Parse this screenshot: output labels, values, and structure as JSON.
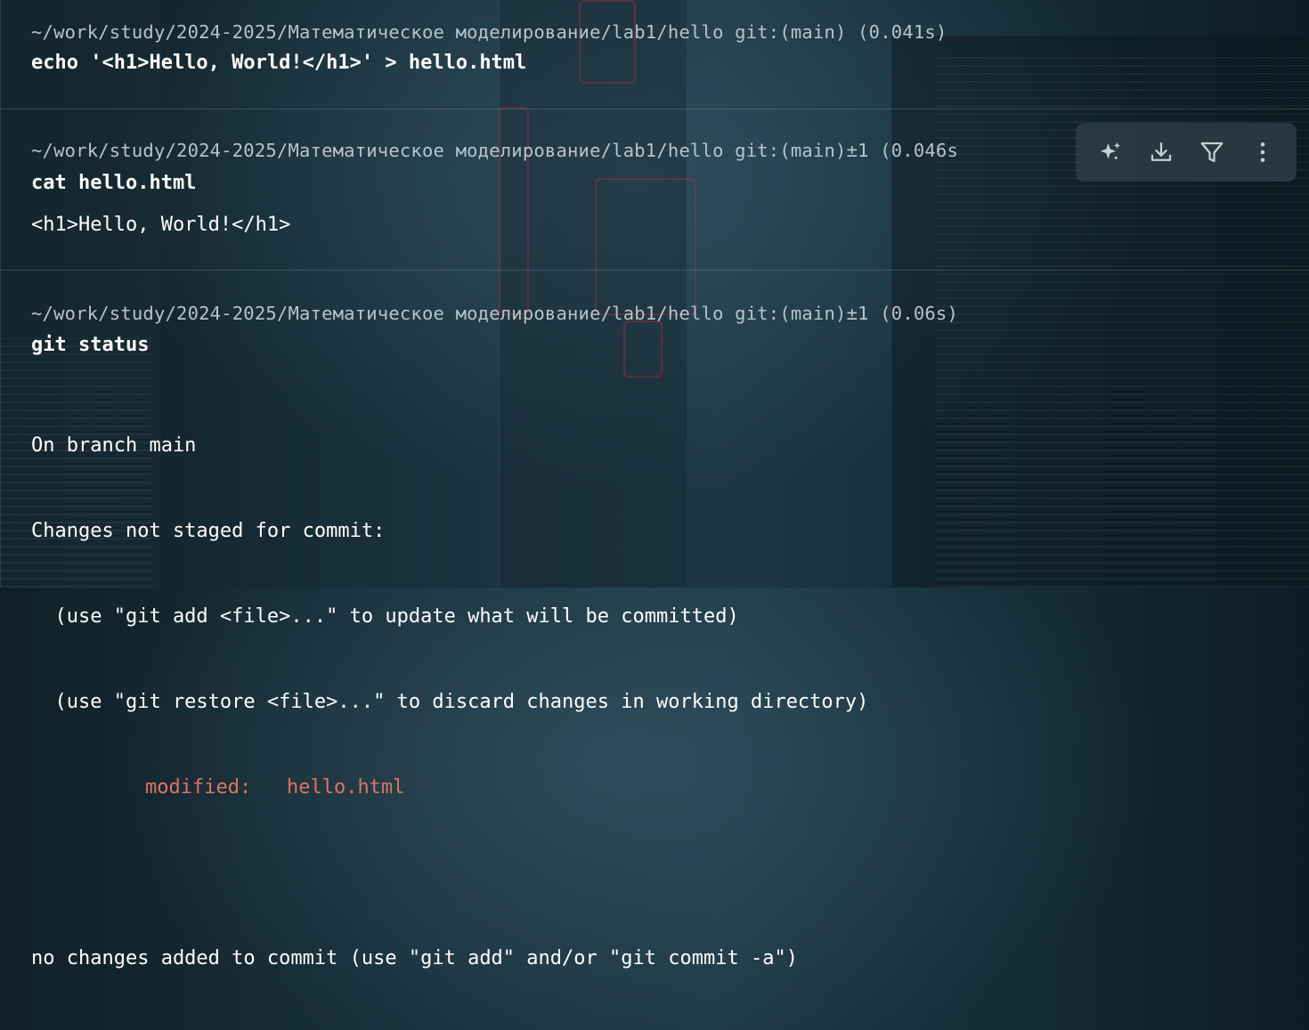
{
  "blocks": [
    {
      "prompt": "~/work/study/2024-2025/Математическое моделирование/lab1/hello git:(main) (0.041s)",
      "command": "echo '<h1>Hello, World!</h1>' > hello.html"
    },
    {
      "prompt": "~/work/study/2024-2025/Математическое моделирование/lab1/hello git:(main)±1 (0.046s",
      "command": "cat hello.html",
      "output": "<h1>Hello, World!</h1>"
    },
    {
      "prompt": "~/work/study/2024-2025/Математическое моделирование/lab1/hello git:(main)±1 (0.06s)",
      "command": "git status",
      "output_lines": [
        "On branch main",
        "Changes not staged for commit:",
        "  (use \"git add <file>...\" to update what will be committed)",
        "  (use \"git restore <file>...\" to discard changes in working directory)"
      ],
      "modified_label": "modified:",
      "modified_file": "hello.html",
      "footer": "no changes added to commit (use \"git add\" and/or \"git commit -a\")"
    }
  ],
  "toolbar": {
    "icons": [
      "ai-sparkle-icon",
      "download-icon",
      "filter-icon",
      "more-vertical-icon"
    ]
  },
  "colors": {
    "prompt": "#b9c3c8",
    "command": "#ffffff",
    "modified": "#e0735f",
    "toolbar_bg": "#2d3c44"
  }
}
